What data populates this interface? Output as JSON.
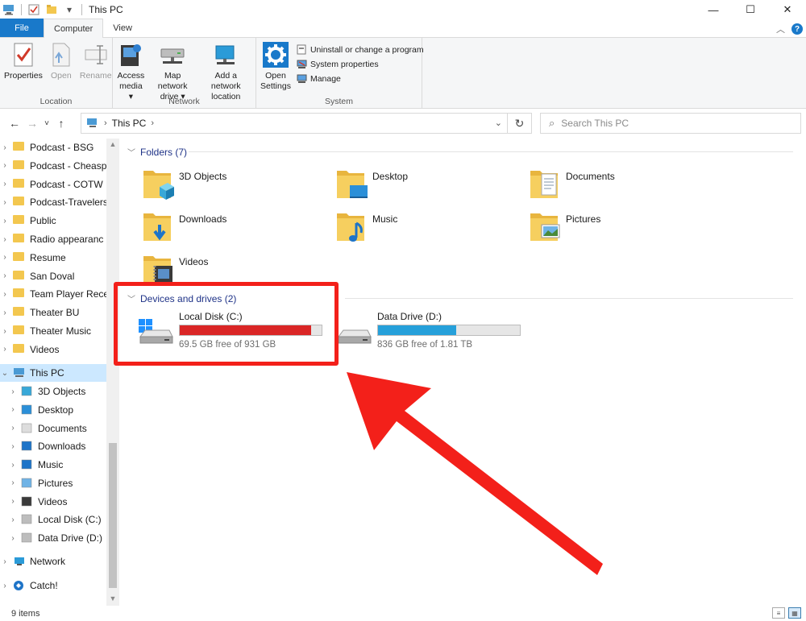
{
  "window": {
    "title": "This PC",
    "controls": {
      "minimize": "—",
      "maximize": "☐",
      "close": "✕"
    }
  },
  "tabs": [
    {
      "label": "File"
    },
    {
      "label": "Computer"
    },
    {
      "label": "View"
    }
  ],
  "ribbon": {
    "groups": {
      "location": "Location",
      "network": "Network",
      "system": "System"
    },
    "location": {
      "properties": "Properties",
      "open": "Open",
      "rename": "Rename"
    },
    "network": {
      "access_media_1": "Access",
      "access_media_2": "media ▾",
      "map_drive_1": "Map network",
      "map_drive_2": "drive ▾",
      "add_location_1": "Add a network",
      "add_location_2": "location"
    },
    "system": {
      "open_settings_1": "Open",
      "open_settings_2": "Settings",
      "uninstall": "Uninstall or change a program",
      "system_properties": "System properties",
      "manage": "Manage"
    }
  },
  "address": {
    "path": "This PC",
    "search_placeholder": "Search This PC"
  },
  "sidebar": {
    "items": [
      {
        "label": "Podcast - BSG",
        "type": "folder"
      },
      {
        "label": "Podcast - Cheasp",
        "type": "folder"
      },
      {
        "label": "Podcast - COTW",
        "type": "folder"
      },
      {
        "label": "Podcast-Travelers",
        "type": "folder"
      },
      {
        "label": "Public",
        "type": "folder"
      },
      {
        "label": "Radio appearanc",
        "type": "folder"
      },
      {
        "label": "Resume",
        "type": "folder"
      },
      {
        "label": "San Doval",
        "type": "folder"
      },
      {
        "label": "Team Player Rece",
        "type": "folder"
      },
      {
        "label": "Theater BU",
        "type": "folder"
      },
      {
        "label": "Theater Music",
        "type": "folder"
      },
      {
        "label": "Videos",
        "type": "folder"
      }
    ],
    "this_pc": "This PC",
    "pc_items": [
      {
        "label": "3D Objects"
      },
      {
        "label": "Desktop"
      },
      {
        "label": "Documents"
      },
      {
        "label": "Downloads"
      },
      {
        "label": "Music"
      },
      {
        "label": "Pictures"
      },
      {
        "label": "Videos"
      },
      {
        "label": "Local Disk (C:)"
      },
      {
        "label": "Data Drive (D:)"
      }
    ],
    "network": "Network",
    "catch": "Catch!"
  },
  "main": {
    "folders_header": "Folders (7)",
    "folders": [
      {
        "label": "3D Objects"
      },
      {
        "label": "Desktop"
      },
      {
        "label": "Documents"
      },
      {
        "label": "Downloads"
      },
      {
        "label": "Music"
      },
      {
        "label": "Pictures"
      },
      {
        "label": "Videos"
      }
    ],
    "drives_header": "Devices and drives (2)",
    "drives": [
      {
        "name": "Local Disk (C:)",
        "free": "69.5 GB free of 931 GB",
        "used_fraction": 0.925,
        "bar_color": "#da2626"
      },
      {
        "name": "Data Drive (D:)",
        "free": "836 GB free of 1.81 TB",
        "used_fraction": 0.55,
        "bar_color": "#26a0da"
      }
    ]
  },
  "status": {
    "items": "9 items"
  },
  "colors": {
    "accent": "#1979ca",
    "highlight": "#f3201a",
    "selected": "#cce8ff"
  }
}
